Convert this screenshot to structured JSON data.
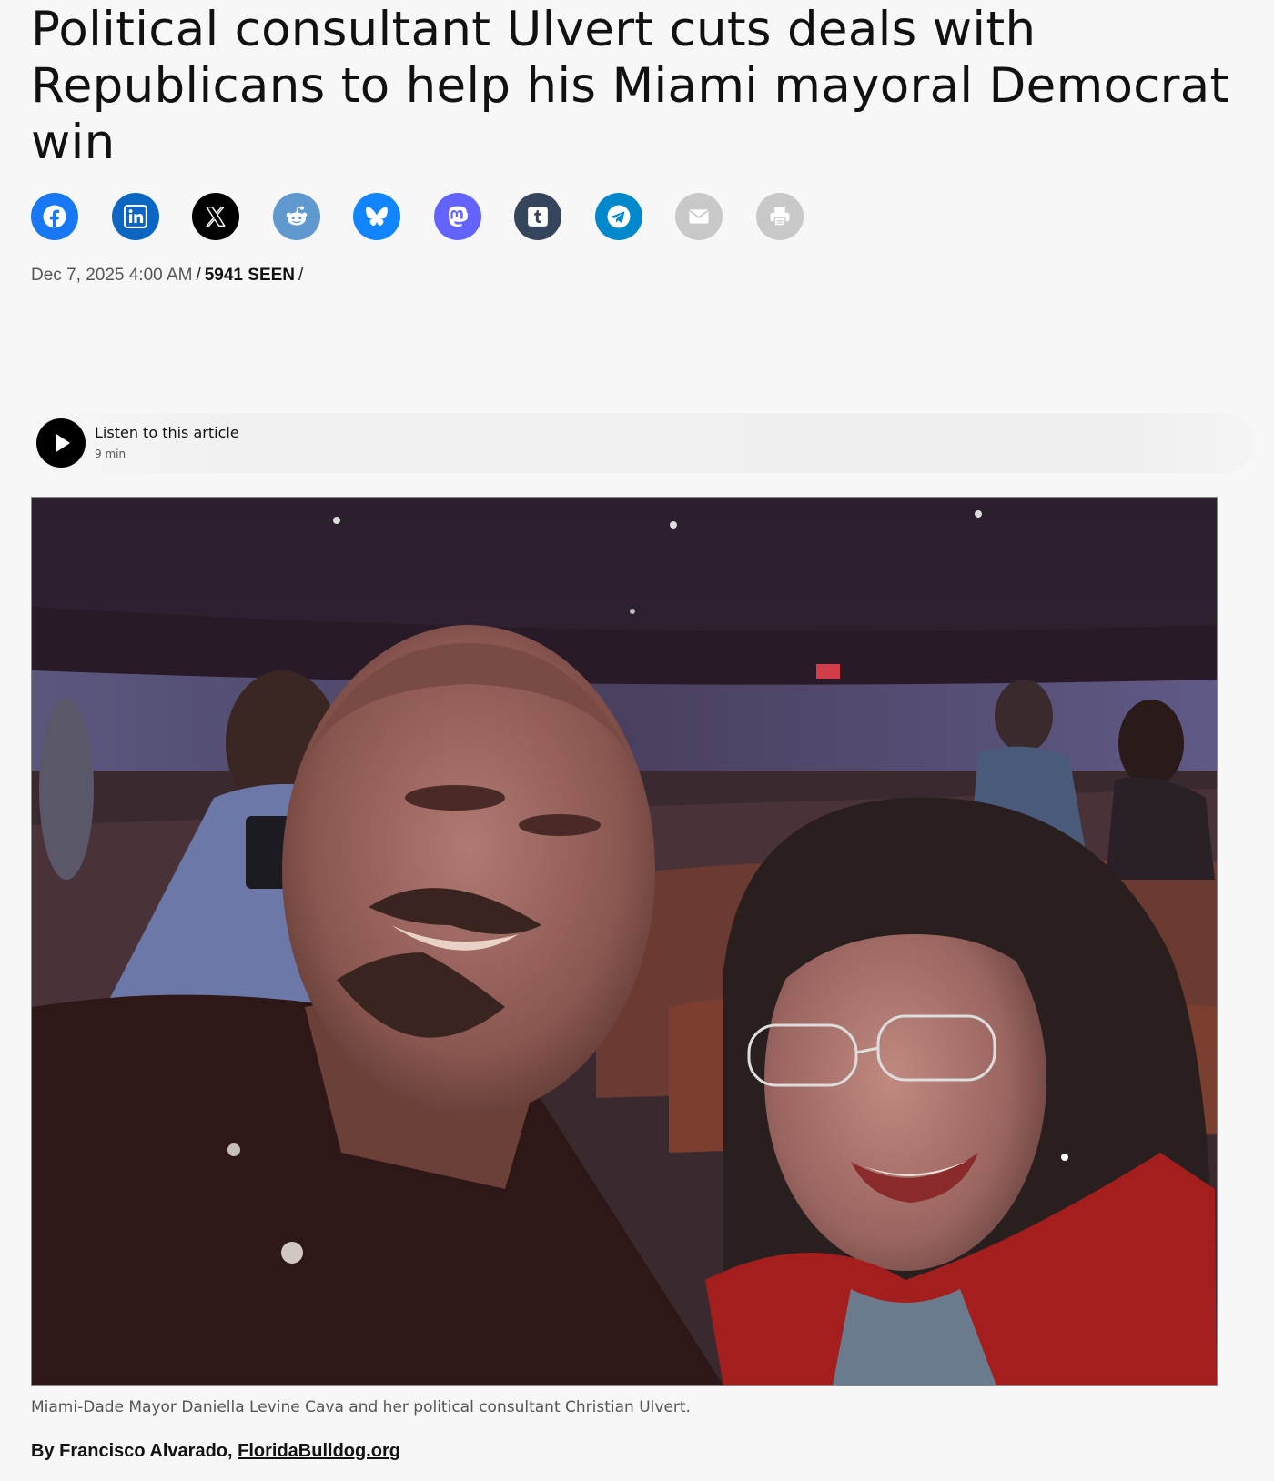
{
  "article": {
    "headline": "Political consultant Ulvert cuts deals with Republicans to help his Miami mayoral Democrat win",
    "date": "Dec 7, 2025 4:00 AM",
    "separator": "/",
    "views": "5941 SEEN",
    "caption": "Miami-Dade Mayor Daniella Levine Cava and her political consultant Christian Ulvert.",
    "byline_prefix": "By Francisco Alvarado,",
    "byline_link": "FloridaBulldog.org"
  },
  "share": [
    {
      "name": "facebook-icon",
      "color": "#1877f2"
    },
    {
      "name": "linkedin-icon",
      "color": "#0a66c2"
    },
    {
      "name": "x-icon",
      "color": "#000000"
    },
    {
      "name": "reddit-icon",
      "color": "#5f99cf"
    },
    {
      "name": "bluesky-icon",
      "color": "#1185fe"
    },
    {
      "name": "mastodon-icon",
      "color": "#6364ff"
    },
    {
      "name": "tumblr-icon",
      "color": "#35465c"
    },
    {
      "name": "telegram-icon",
      "color": "#0088cc"
    },
    {
      "name": "email-icon",
      "color": "#c8c8c8"
    },
    {
      "name": "print-icon",
      "color": "#c8c8c8"
    }
  ],
  "player": {
    "label": "Listen to this article",
    "duration": "9 min"
  }
}
